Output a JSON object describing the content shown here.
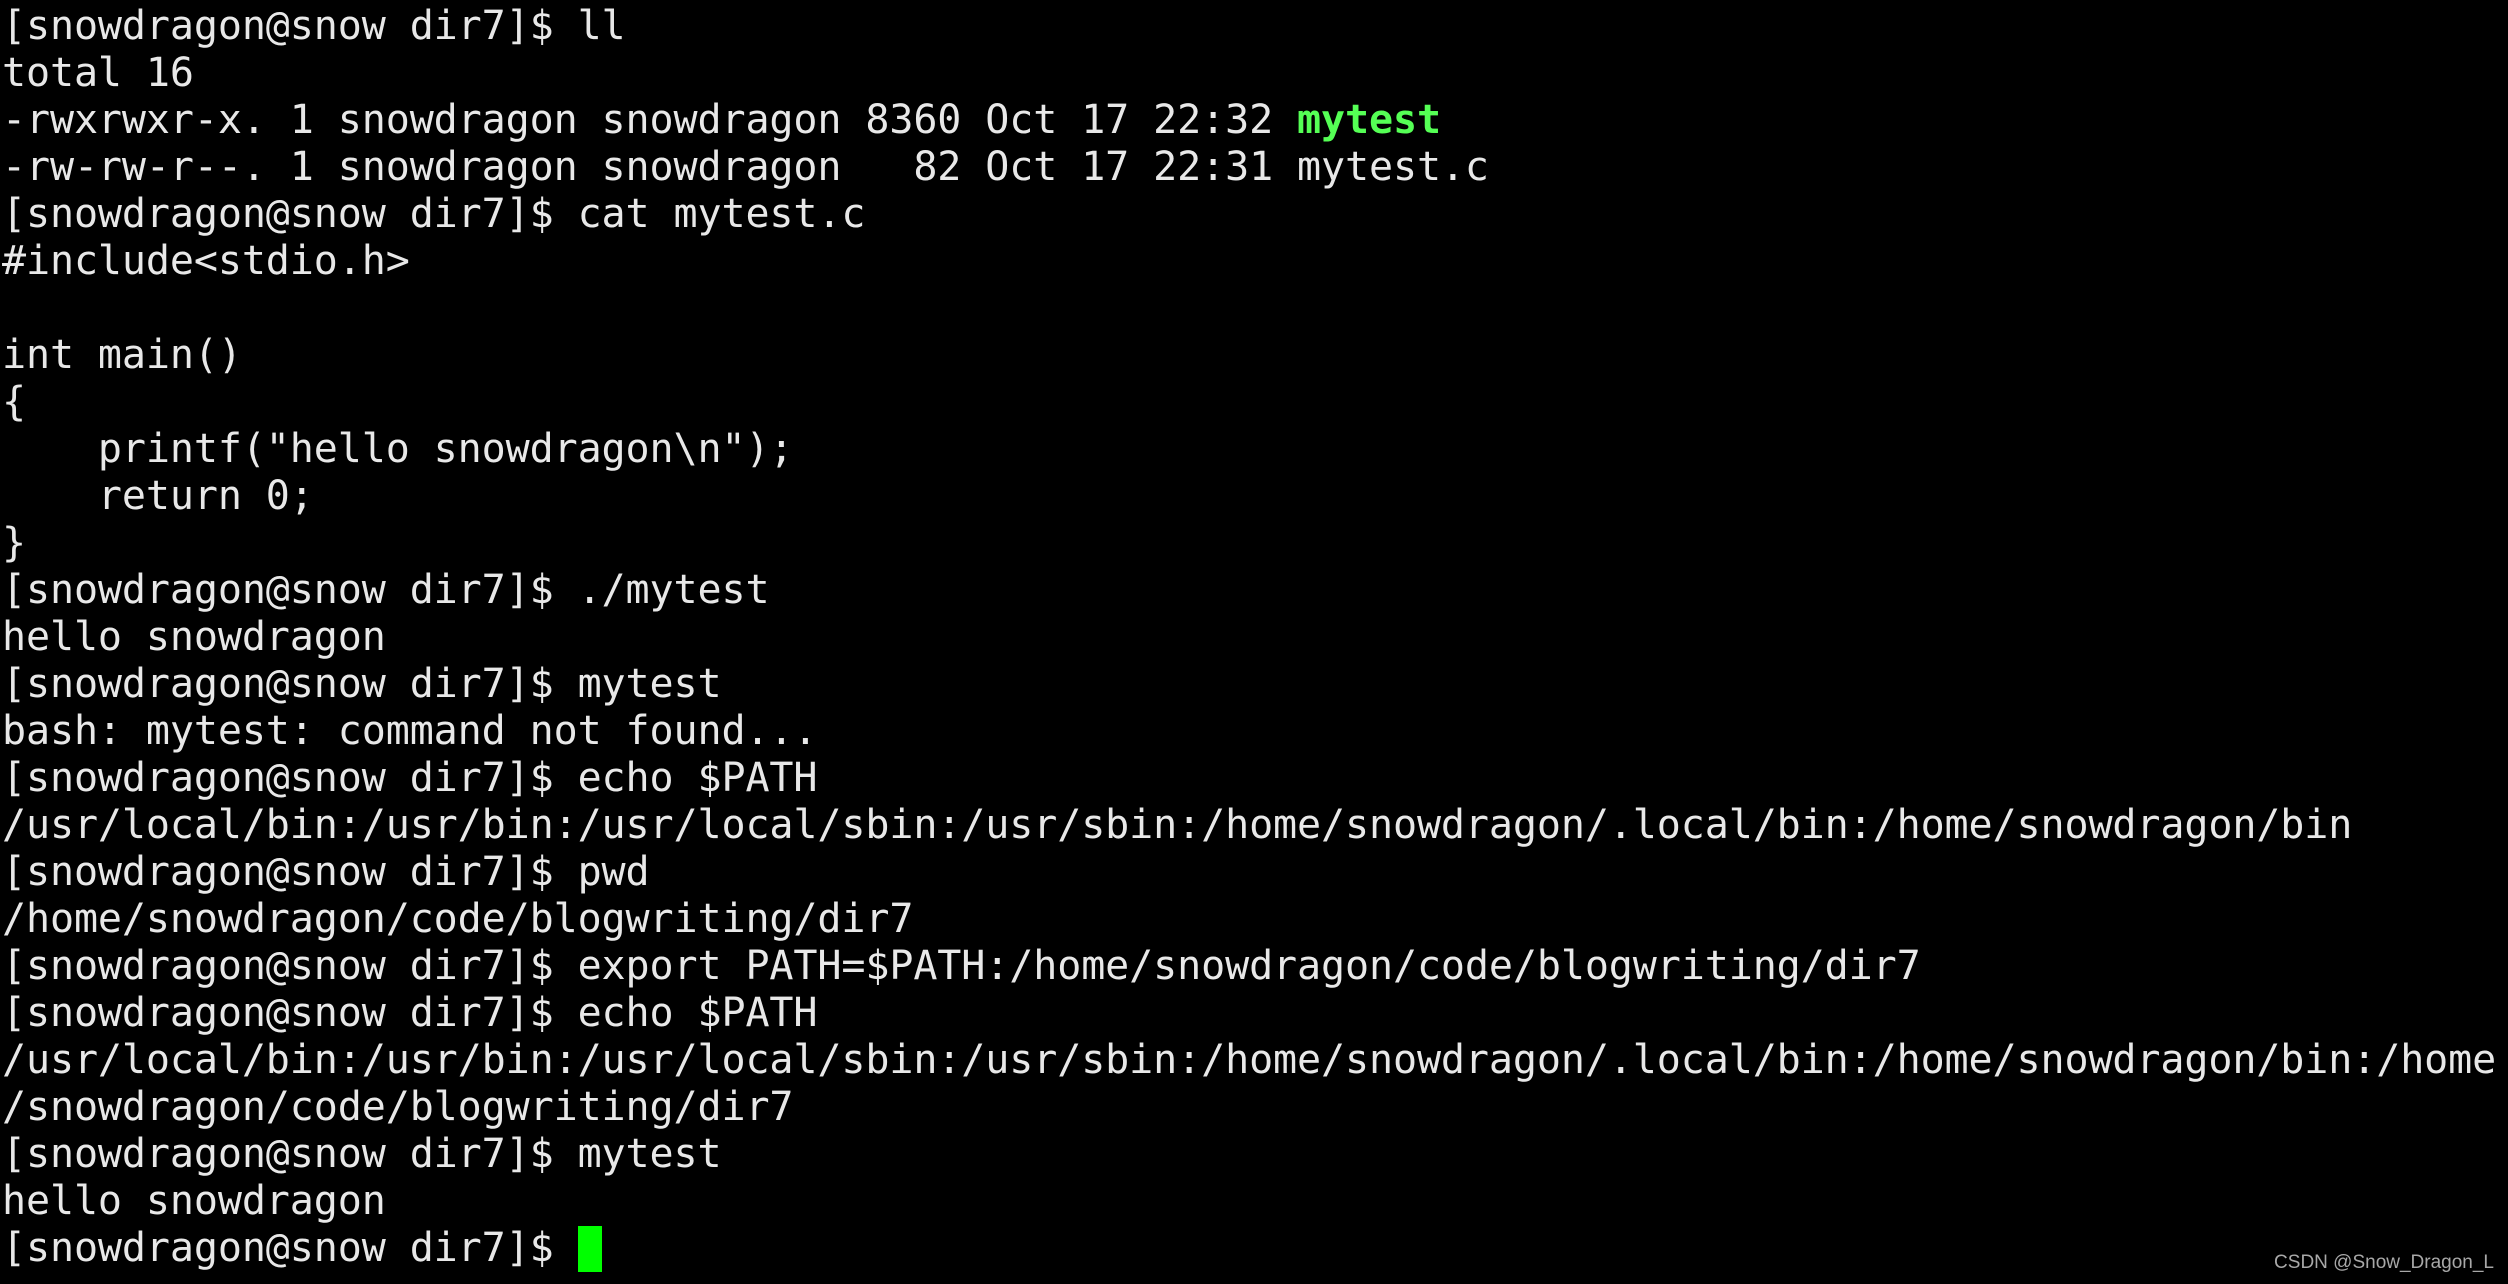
{
  "terminal": {
    "background": "#000000",
    "foreground": "#e8e8e8",
    "executable_color": "#55ff55",
    "cursor_color": "#00ff00",
    "prompt": "[snowdragon@snow dir7]$ ",
    "lines": [
      {
        "type": "command",
        "text": "[snowdragon@snow dir7]$ ll"
      },
      {
        "type": "output",
        "text": "total 16"
      },
      {
        "type": "output",
        "text": "-rwxrwxr-x. 1 snowdragon snowdragon 8360 Oct 17 22:32 ",
        "highlight": "mytest"
      },
      {
        "type": "output",
        "text": "-rw-rw-r--. 1 snowdragon snowdragon   82 Oct 17 22:31 mytest.c"
      },
      {
        "type": "command",
        "text": "[snowdragon@snow dir7]$ cat mytest.c"
      },
      {
        "type": "output",
        "text": "#include<stdio.h>"
      },
      {
        "type": "output",
        "text": ""
      },
      {
        "type": "output",
        "text": "int main()"
      },
      {
        "type": "output",
        "text": "{"
      },
      {
        "type": "output",
        "text": "    printf(\"hello snowdragon\\n\");"
      },
      {
        "type": "output",
        "text": "    return 0;"
      },
      {
        "type": "output",
        "text": "}"
      },
      {
        "type": "command",
        "text": "[snowdragon@snow dir7]$ ./mytest"
      },
      {
        "type": "output",
        "text": "hello snowdragon"
      },
      {
        "type": "command",
        "text": "[snowdragon@snow dir7]$ mytest"
      },
      {
        "type": "output",
        "text": "bash: mytest: command not found..."
      },
      {
        "type": "command",
        "text": "[snowdragon@snow dir7]$ echo $PATH"
      },
      {
        "type": "output",
        "text": "/usr/local/bin:/usr/bin:/usr/local/sbin:/usr/sbin:/home/snowdragon/.local/bin:/home/snowdragon/bin"
      },
      {
        "type": "command",
        "text": "[snowdragon@snow dir7]$ pwd"
      },
      {
        "type": "output",
        "text": "/home/snowdragon/code/blogwriting/dir7"
      },
      {
        "type": "command",
        "text": "[snowdragon@snow dir7]$ export PATH=$PATH:/home/snowdragon/code/blogwriting/dir7"
      },
      {
        "type": "command",
        "text": "[snowdragon@snow dir7]$ echo $PATH"
      },
      {
        "type": "output",
        "text": "/usr/local/bin:/usr/bin:/usr/local/sbin:/usr/sbin:/home/snowdragon/.local/bin:/home/snowdragon/bin:/home"
      },
      {
        "type": "output",
        "text": "/snowdragon/code/blogwriting/dir7"
      },
      {
        "type": "command",
        "text": "[snowdragon@snow dir7]$ mytest"
      },
      {
        "type": "output",
        "text": "hello snowdragon"
      },
      {
        "type": "prompt",
        "text": "[snowdragon@snow dir7]$ "
      }
    ]
  },
  "watermark": "CSDN @Snow_Dragon_L"
}
